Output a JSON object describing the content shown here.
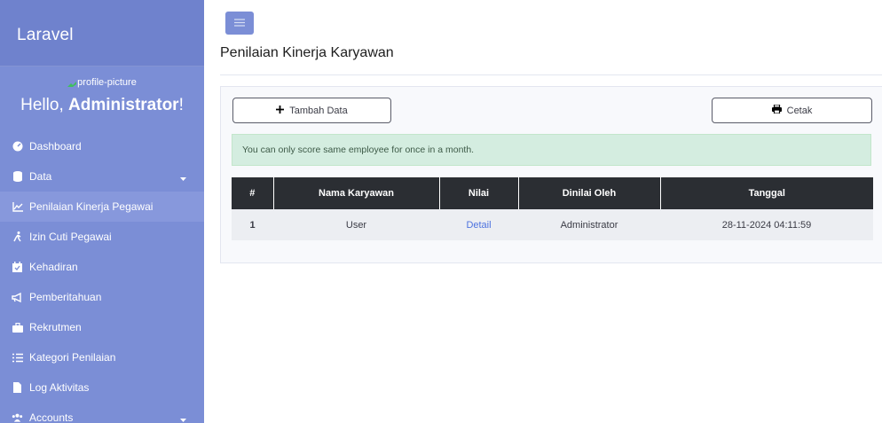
{
  "sidebar": {
    "brand": "Laravel",
    "profile_picture_alt": "profile-picture",
    "greeting": "Hello, ",
    "user_name": "Administrator",
    "greeting_suffix": "!",
    "items": [
      {
        "label": "Dashboard",
        "icon": "tachometer-icon"
      },
      {
        "label": "Data",
        "icon": "database-icon",
        "has_caret": true
      },
      {
        "label": "Penilaian Kinerja Pegawai",
        "icon": "chart-line-icon",
        "active": true
      },
      {
        "label": "Izin Cuti Pegawai",
        "icon": "walking-person-icon"
      },
      {
        "label": "Kehadiran",
        "icon": "calendar-check-icon"
      },
      {
        "label": "Pemberitahuan",
        "icon": "megaphone-icon"
      },
      {
        "label": "Rekrutmen",
        "icon": "briefcase-icon"
      },
      {
        "label": "Kategori Penilaian",
        "icon": "list-check-icon"
      },
      {
        "label": "Log Aktivitas",
        "icon": "file-icon"
      },
      {
        "label": "Accounts",
        "icon": "users-icon",
        "has_caret": true
      }
    ]
  },
  "header": {
    "page_title": "Penilaian Kinerja Karyawan"
  },
  "toolbar": {
    "add_label": "Tambah Data",
    "print_label": "Cetak"
  },
  "alert": {
    "message": "You can only score same employee for once in a month."
  },
  "table": {
    "headers": [
      "#",
      "Nama Karyawan",
      "Nilai",
      "Dinilai Oleh",
      "Tanggal"
    ],
    "rows": [
      {
        "num": "1",
        "name": "User",
        "score_link": "Detail",
        "rated_by": "Administrator",
        "date": "28-11-2024 04:11:59"
      }
    ]
  },
  "colors": {
    "sidebar": "#7b8ed6",
    "sidebar_active": "#8798dc",
    "table_header": "#2b2e33",
    "alert_bg": "#d4ede0",
    "link": "#4e73df"
  }
}
